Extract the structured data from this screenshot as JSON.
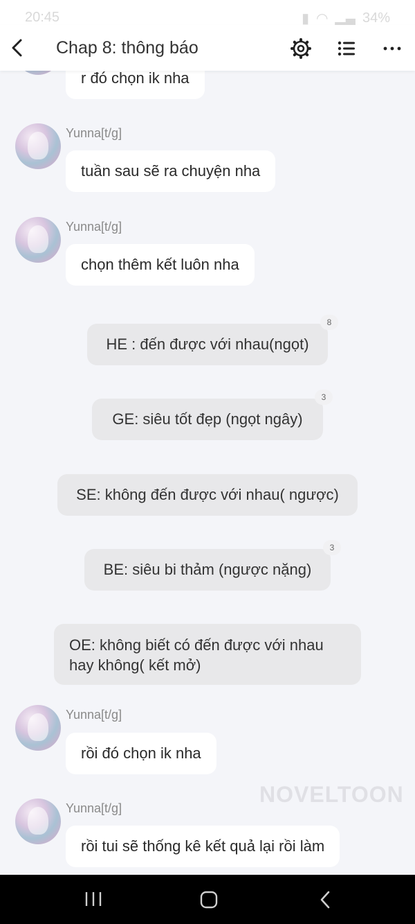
{
  "status": {
    "time": "20:45",
    "battery": "34%"
  },
  "header": {
    "title": "Chap 8: thông báo"
  },
  "messages": [
    {
      "text": "r đó chọn ik nha"
    },
    {
      "author": "Yunna[t/g]",
      "text": "tuần sau sẽ ra chuyện nha"
    },
    {
      "author": "Yunna[t/g]",
      "text": "chọn thêm kết luôn nha"
    },
    {
      "author": "Yunna[t/g]",
      "text": "rồi đó chọn ik nha"
    },
    {
      "author": "Yunna[t/g]",
      "text": "rồi tui sẽ thống kê kết quả lại rồi làm"
    }
  ],
  "choices": [
    {
      "text": "HE : đến được với nhau(ngọt)",
      "badge": "8"
    },
    {
      "text": "GE: siêu tốt đẹp (ngọt ngây)",
      "badge": "3"
    },
    {
      "text": "SE: không đến được với nhau( ngược)"
    },
    {
      "text": "BE: siêu bi thảm (ngược nặng)",
      "badge": "3"
    },
    {
      "text_line1": "OE: không biết có đến được với nhau",
      "text_line2": "hay không( kết mở)"
    }
  ],
  "watermark": "NOVELTOON"
}
